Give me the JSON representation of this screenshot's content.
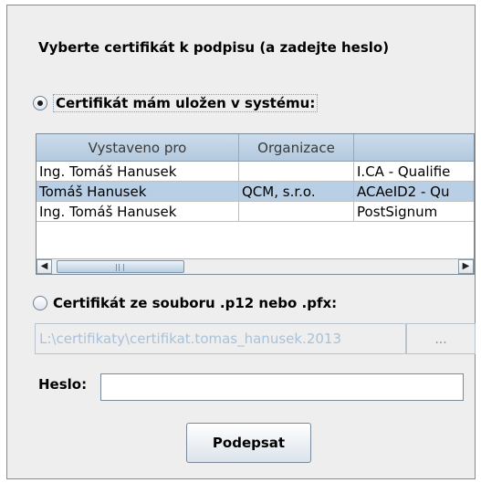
{
  "heading": "Vyberte certifikát k podpisu (a zadejte heslo)",
  "option_system": {
    "label": "Certifikát mám uložen v systému:",
    "checked": true
  },
  "table": {
    "columns": [
      "Vystaveno pro",
      "Organizace",
      ""
    ],
    "rows": [
      [
        "Ing. Tomáš Hanusek",
        "",
        "I.CA - Qualifie"
      ],
      [
        "Tomáš Hanusek",
        "QCM, s.r.o.",
        "ACAeID2 - Qu"
      ],
      [
        "Ing. Tomáš Hanusek",
        "",
        "PostSignum"
      ]
    ],
    "selected_row": 1
  },
  "option_file": {
    "label": "Certifikát ze souboru .p12 nebo .pfx:",
    "checked": false
  },
  "file_path": {
    "value": "L:\\certifikaty\\certifikat.tomas_hanusek.2013"
  },
  "browse_button": {
    "label": "..."
  },
  "password": {
    "label": "Heslo:",
    "value": ""
  },
  "sign_button": {
    "label": "Podepsat"
  },
  "icons": {
    "scroll_left": "arrow-left-icon",
    "scroll_right": "arrow-right-icon",
    "scroll_grip": "grip-icon"
  },
  "colors": {
    "panel_bg": "#eeeeee",
    "table_header_bg": "#b8cfe5",
    "selected_row_bg": "#b8cfe5",
    "disabled_text": "#a8c2da"
  }
}
